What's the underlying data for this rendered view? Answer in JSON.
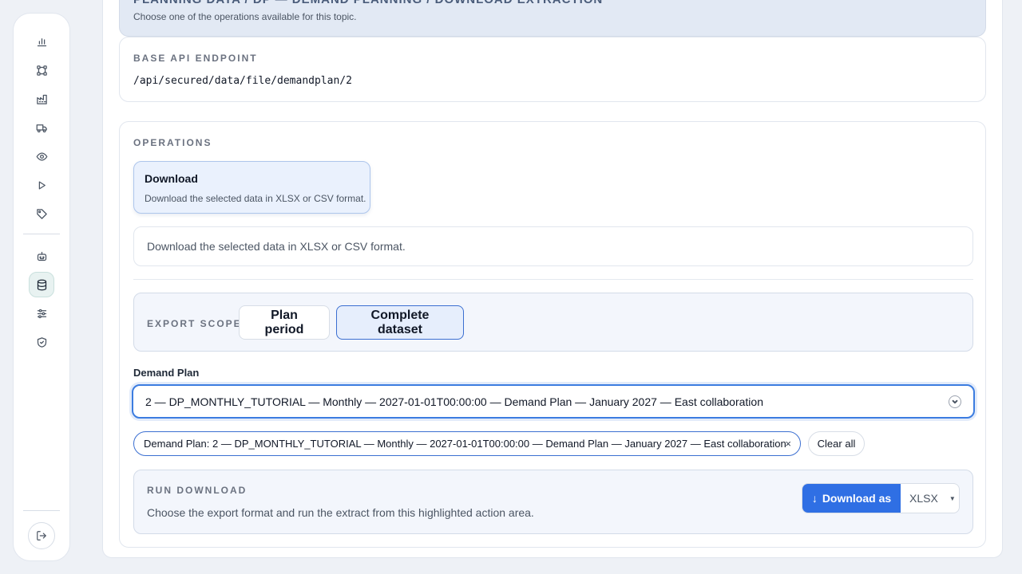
{
  "sidebar": {
    "icons": [
      "bar-chart-icon",
      "network-icon",
      "factory-icon",
      "truck-icon",
      "eye-icon",
      "play-icon",
      "tag-icon",
      "robot-icon",
      "database-icon",
      "sliders-icon",
      "shield-icon"
    ],
    "active": "database-icon",
    "logout_icon": "logout-icon"
  },
  "header": {
    "title": "PLANNING DATA / DP — DEMAND PLANNING / DOWNLOAD EXTRACTION",
    "subtitle": "Choose one of the operations available for this topic."
  },
  "endpoint": {
    "label": "Base API endpoint",
    "value": "/api/secured/data/file/demandplan/2"
  },
  "operations": {
    "label": "Operations",
    "tile": {
      "title": "Download",
      "description": "Download the selected data in XLSX or CSV format."
    },
    "description_box": "Download the selected data in XLSX or CSV format."
  },
  "export_scope": {
    "label": "Export scope",
    "options": [
      "Plan period",
      "Complete dataset"
    ],
    "selected": "Complete dataset"
  },
  "demand_plan": {
    "label": "Demand Plan",
    "value": "2 — DP_MONTHLY_TUTORIAL — Monthly — 2027-01-01T00:00:00 — Demand Plan — January 2027 — East collaboration",
    "chip": "Demand Plan: 2 — DP_MONTHLY_TUTORIAL — Monthly — 2027-01-01T00:00:00 — Demand Plan — January 2027 — East collaboration",
    "chip_remove": "×",
    "clear_all": "Clear all"
  },
  "run_download": {
    "label": "Run download",
    "description": "Choose the export format and run the extract from this highlighted action area.",
    "button_icon": "↓",
    "button_label": "Download as",
    "format": "XLSX",
    "format_caret": "▼"
  },
  "colors": {
    "accent": "#2f6fe4",
    "header_bg": "#e2e9f4",
    "active_nav": "#e8f2f1"
  }
}
